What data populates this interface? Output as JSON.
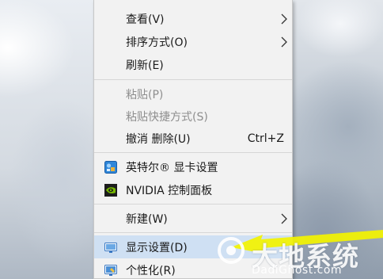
{
  "menu": {
    "items": [
      {
        "label": "查看(V)",
        "submenu": true
      },
      {
        "label": "排序方式(O)",
        "submenu": true
      },
      {
        "label": "刷新(E)"
      },
      {
        "label": "粘贴(P)",
        "disabled": true
      },
      {
        "label": "粘贴快捷方式(S)",
        "disabled": true
      },
      {
        "label": "撤消 删除(U)",
        "shortcut": "Ctrl+Z"
      },
      {
        "label": "英特尔® 显卡设置",
        "icon": "intel-graphics-icon"
      },
      {
        "label": "NVIDIA 控制面板",
        "icon": "nvidia-icon"
      },
      {
        "label": "新建(W)",
        "submenu": true
      },
      {
        "label": "显示设置(D)",
        "icon": "display-settings-icon",
        "highlighted": true
      },
      {
        "label": "个性化(R)",
        "icon": "personalize-icon"
      }
    ]
  },
  "watermark": {
    "title": "大地系统",
    "subtitle": "DadiGhost.com"
  },
  "colors": {
    "menu_bg": "#f2f2f2",
    "highlight_bg": "#cfe0f3",
    "disabled_text": "#8e8e8e",
    "annotation_arrow": "#f3f300"
  }
}
